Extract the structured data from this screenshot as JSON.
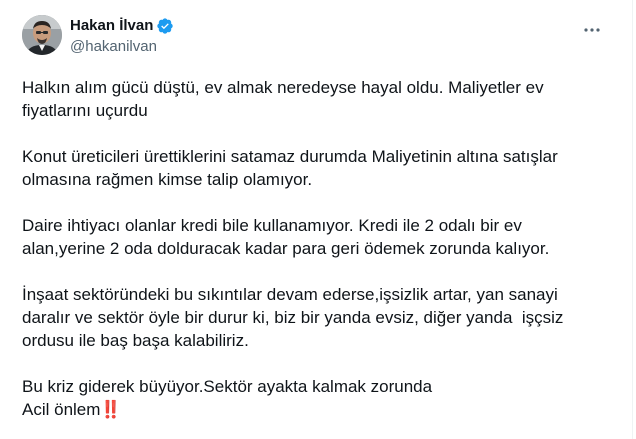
{
  "author": {
    "display_name": "Hakan İlvan",
    "handle": "@hakanilvan",
    "verified": true,
    "avatar_icon": "profile-photo",
    "verified_icon": "verified-badge-icon",
    "verified_color": "#1d9bf0"
  },
  "menu": {
    "icon": "more-options-icon"
  },
  "tweet": {
    "paragraphs": [
      "Halkın alım gücü düştü, ev almak neredeyse hayal oldu. Maliyetler ev\nfiyatlarını uçurdu",
      "Konut üreticileri ürettiklerini satamaz durumda Maliyetinin altına satışlar\nolmasına rağmen kimse talip olamıyor.",
      "Daire ihtiyacı olanlar kredi bile kullanamıyor. Kredi ile 2 odalı bir ev\nalan,yerine 2 oda dolduracak kadar para geri ödemek zorunda kalıyor.",
      "İnşaat sektöründeki bu sıkıntılar devam ederse,işsizlik artar, yan sanayi\ndaralır ve sektör öyle bir durur ki, biz bir yanda evsiz, diğer yanda  işçsiz\nordusu ile baş başa kalabiliriz."
    ],
    "last_line_1": "Bu kriz giderek büyüyor.Sektör ayakta kalmak zorunda",
    "last_line_2": "Acil önlem",
    "last_emoji": "‼️"
  },
  "colors": {
    "text": "#0f1419",
    "secondary": "#536471",
    "emoji": "#e0245e"
  }
}
